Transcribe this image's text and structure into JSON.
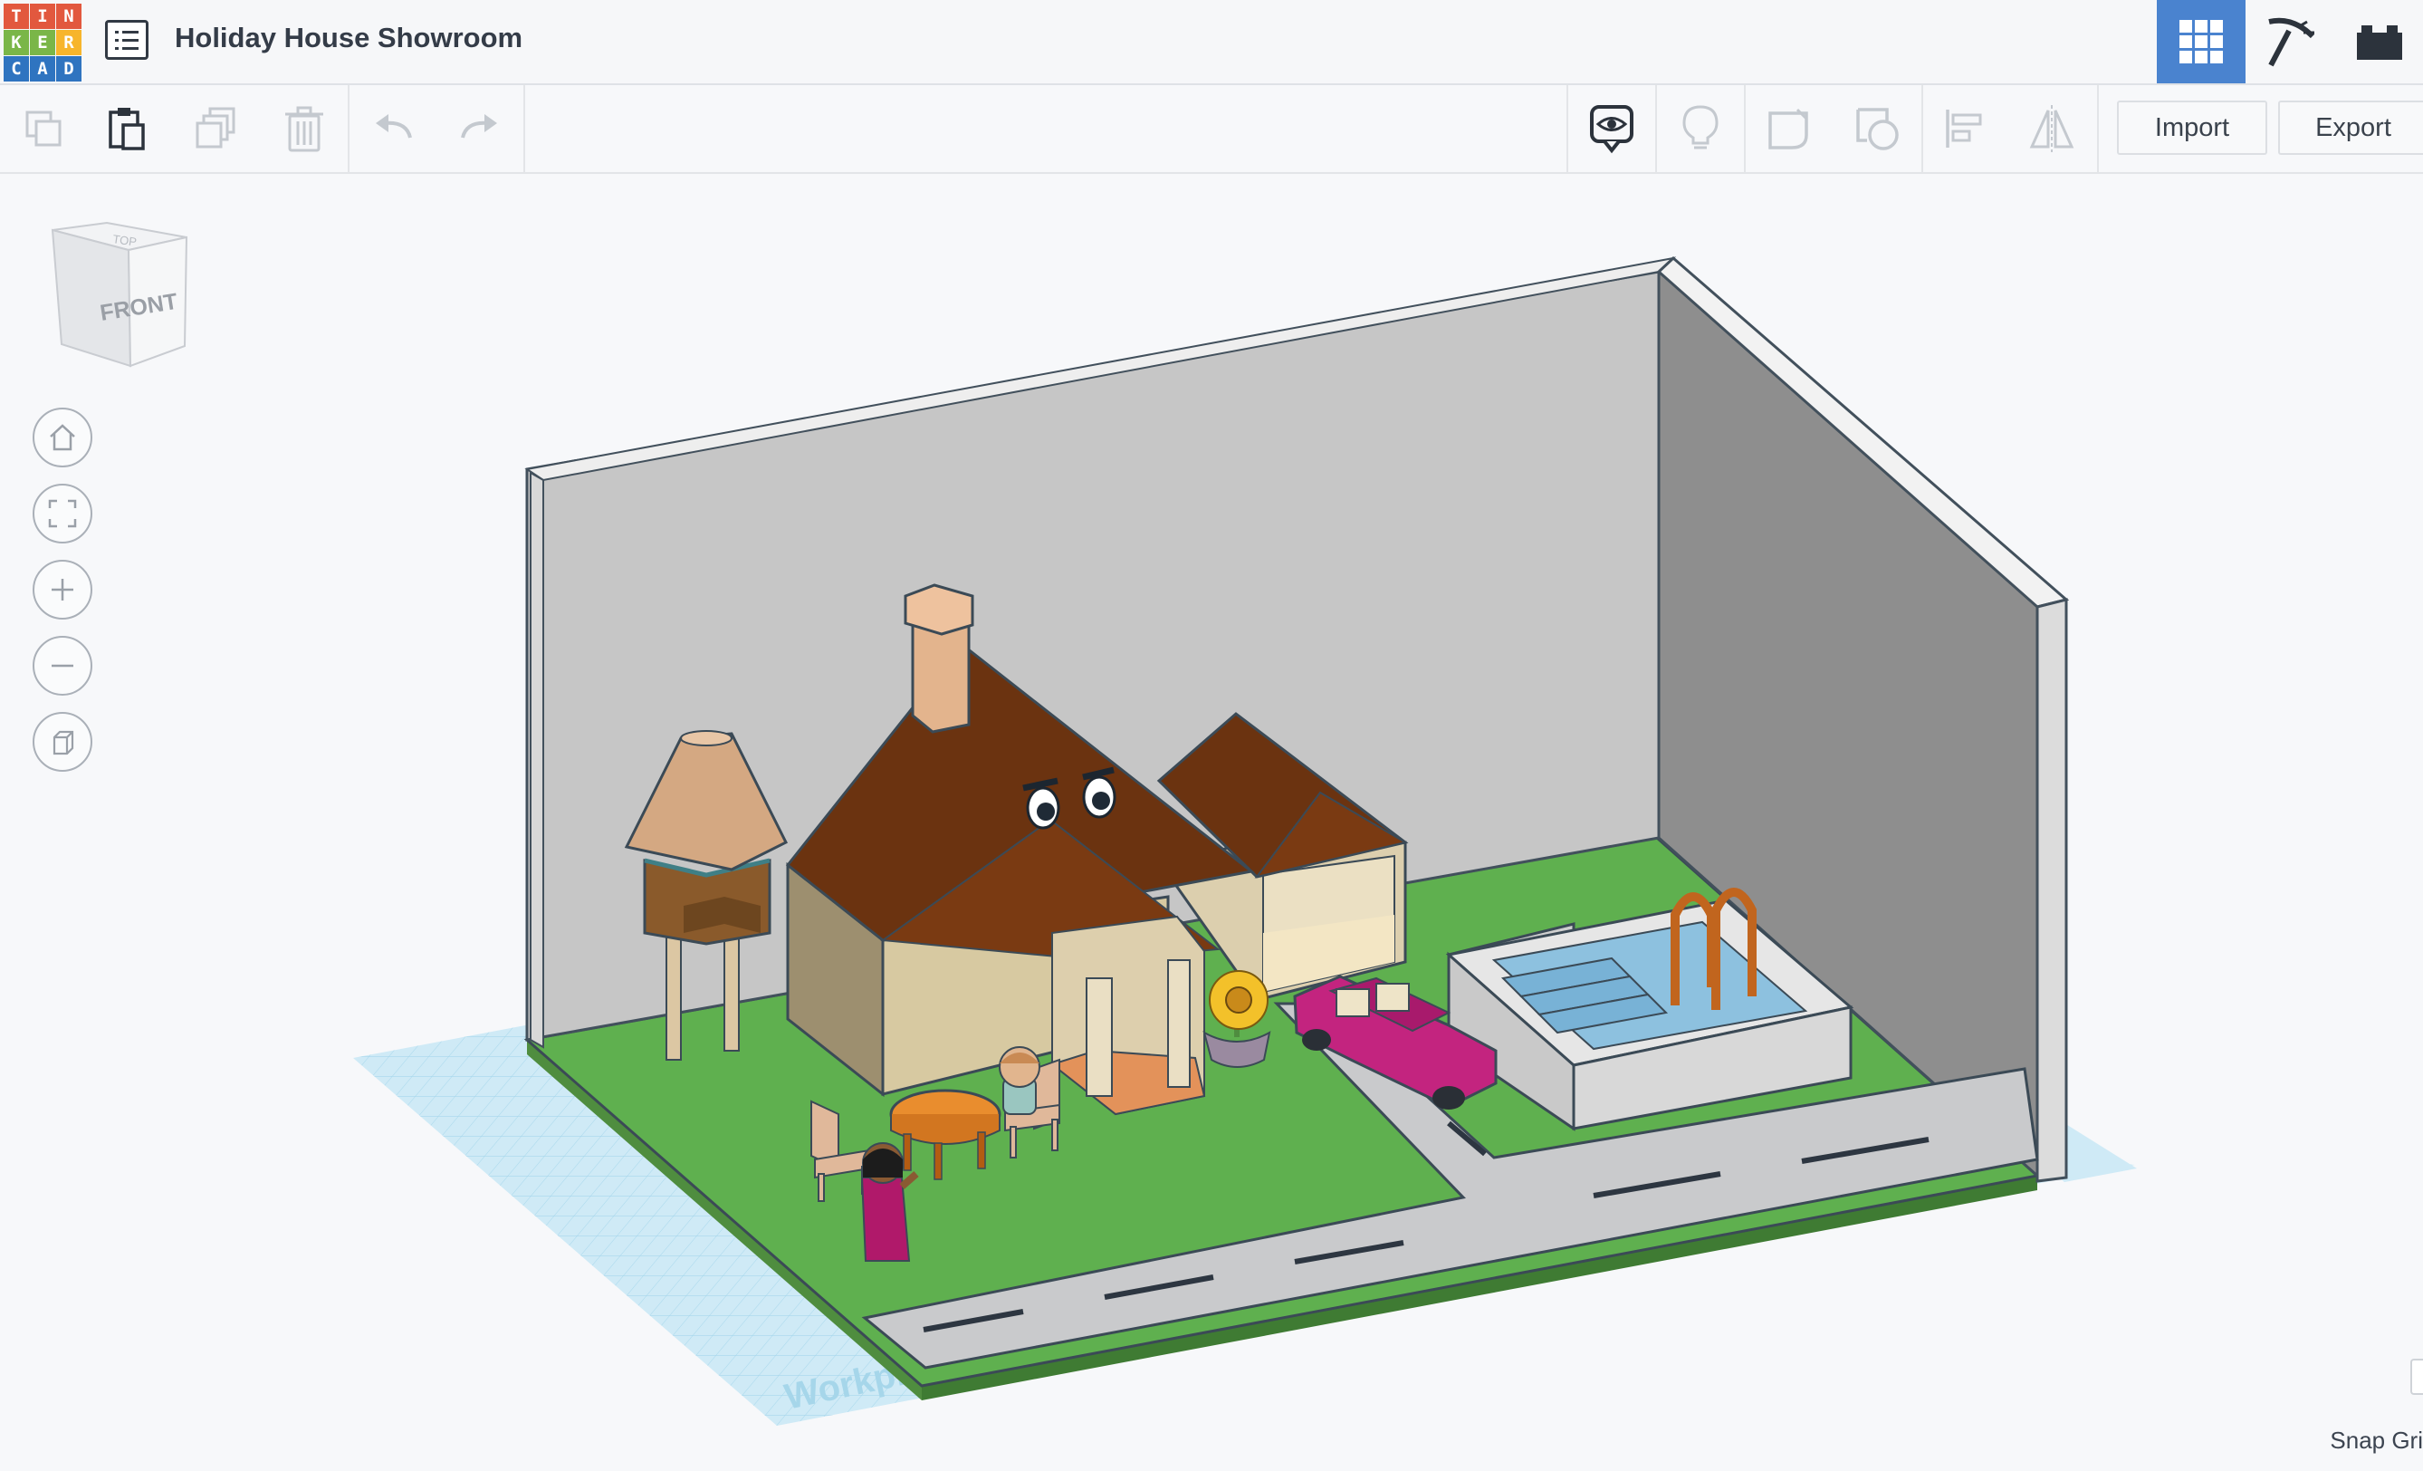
{
  "app": {
    "logo_letters": [
      "T",
      "I",
      "N",
      "K",
      "E",
      "R",
      "C",
      "A",
      "D"
    ],
    "logo_colors": [
      "#e2583e",
      "#e2583e",
      "#e2583e",
      "#7ab648",
      "#7ab648",
      "#f7b52c",
      "#2f74c0",
      "#2f74c0",
      "#2f74c0"
    ],
    "title": "Holiday House Showroom",
    "accent_color": "#4a83cf"
  },
  "header": {
    "menu_icon": "list-icon",
    "view_buttons": [
      {
        "icon": "grid-3d-icon",
        "active": true
      },
      {
        "icon": "pickaxe-icon",
        "active": false
      },
      {
        "icon": "bricks-icon",
        "active": false
      }
    ]
  },
  "toolbar": {
    "left_icons": [
      "copy-icon",
      "paste-icon",
      "duplicate-icon",
      "delete-icon",
      "undo-icon",
      "redo-icon"
    ],
    "right_icons": [
      "visibility-icon",
      "lightbulb-icon",
      "shape-note-icon",
      "group-icon",
      "align-icon",
      "mirror-icon"
    ],
    "import_label": "Import",
    "export_label": "Export"
  },
  "viewcube": {
    "front_label": "FRONT",
    "top_label": "TOP"
  },
  "nav_controls": [
    "home-view-icon",
    "fit-view-icon",
    "zoom-in-icon",
    "zoom-out-icon",
    "ortho-view-icon"
  ],
  "workplane_label": "Workplane",
  "snap_label": "Snap Gri"
}
